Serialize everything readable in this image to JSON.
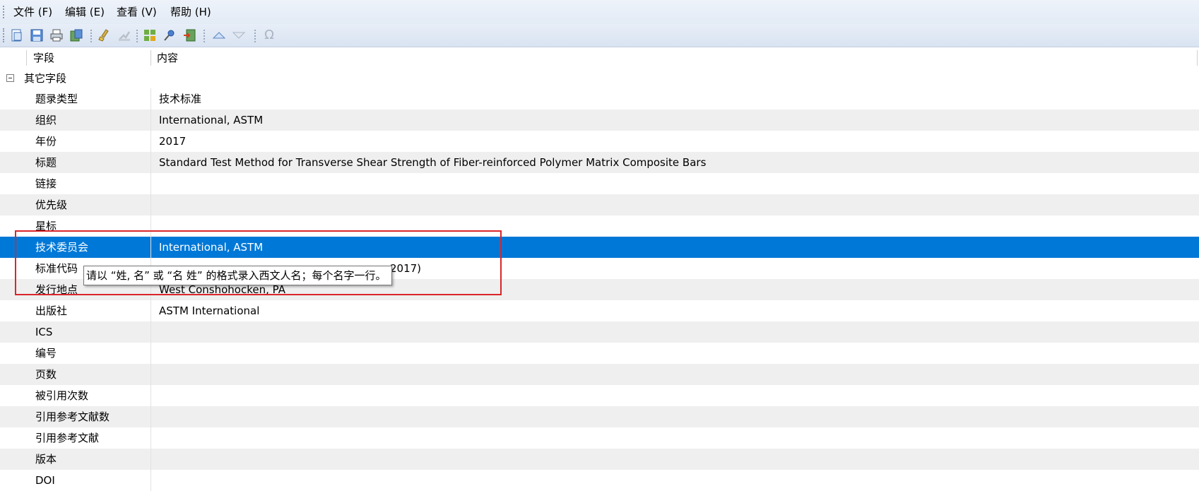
{
  "menu": [
    {
      "label": "文件 (F)"
    },
    {
      "label": "编辑 (E)"
    },
    {
      "label": "查看 (V)"
    },
    {
      "label": "帮助 (H)"
    }
  ],
  "toolbar": {
    "icons": [
      "new-record-icon",
      "save-icon",
      "print-icon",
      "export-icon",
      "clean-icon",
      "disabled-tool-icon",
      "grid-view-icon",
      "pin-icon",
      "import-icon",
      "move-up-icon",
      "move-down-icon",
      "omega-icon"
    ]
  },
  "grid": {
    "columns": [
      {
        "label": "字段"
      },
      {
        "label": "内容"
      }
    ],
    "group": {
      "label": "其它字段"
    },
    "rows": [
      {
        "field": "题录类型",
        "content": "技术标准"
      },
      {
        "field": "组织",
        "content": "International, ASTM"
      },
      {
        "field": "年份",
        "content": "2017"
      },
      {
        "field": "标题",
        "content": "Standard Test Method for Transverse Shear Strength of Fiber-reinforced Polymer Matrix Composite Bars"
      },
      {
        "field": "链接",
        "content": ""
      },
      {
        "field": "优先级",
        "content": ""
      },
      {
        "field": "星标",
        "content": ""
      },
      {
        "field": "技术委员会",
        "content": "International, ASTM"
      },
      {
        "field": "标准代码",
        "content": "2017)"
      },
      {
        "field": "发行地点",
        "content": "West Conshohocken, PA"
      },
      {
        "field": "出版社",
        "content": "ASTM International"
      },
      {
        "field": "ICS",
        "content": ""
      },
      {
        "field": "编号",
        "content": ""
      },
      {
        "field": "页数",
        "content": ""
      },
      {
        "field": "被引用次数",
        "content": ""
      },
      {
        "field": "引用参考文献数",
        "content": ""
      },
      {
        "field": "引用参考文献",
        "content": ""
      },
      {
        "field": "版本",
        "content": ""
      },
      {
        "field": "DOI",
        "content": ""
      }
    ],
    "selected_field": "技术委员会"
  },
  "tooltip": {
    "text": "请以 “姓, 名” 或 “名 姓” 的格式录入西文人名；每个名字一行。"
  },
  "colors": {
    "selection": "#0078d7",
    "annotation_border": "#d9262b"
  }
}
